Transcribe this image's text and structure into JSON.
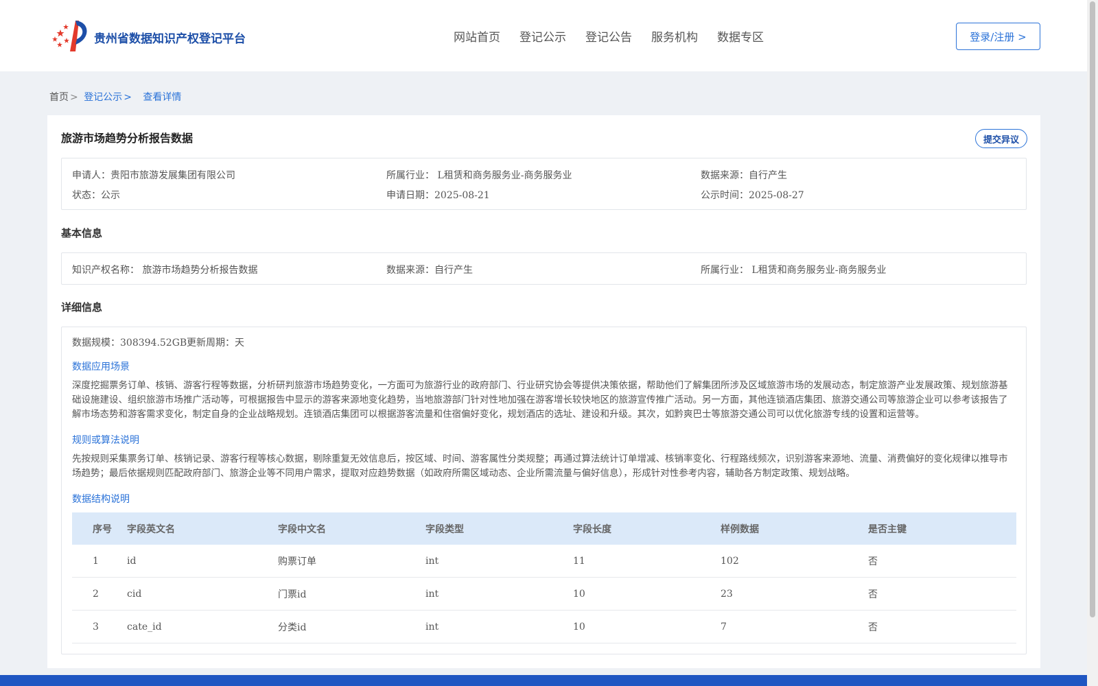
{
  "header": {
    "site_title": "贵州省数据知识产权登记平台",
    "nav": [
      "网站首页",
      "登记公示",
      "登记公告",
      "服务机构",
      "数据专区"
    ],
    "login_label": "登录/注册 >"
  },
  "breadcrumb": {
    "home": "首页",
    "sep": ">",
    "level2": "登记公示",
    "current": "查看详情"
  },
  "detail": {
    "title": "旅游市场趋势分析报告数据",
    "objection_label": "提交异议",
    "summary": {
      "applicant_label": "申请人：",
      "applicant": "贵阳市旅游发展集团有限公司",
      "industry_label": "所属行业：",
      "industry": "L租赁和商务服务业-商务服务业",
      "source_label": "数据来源：",
      "source": "自行产生",
      "status_label": "状态：",
      "status": "公示",
      "apply_date_label": "申请日期：",
      "apply_date": "2025-08-21",
      "publish_time_label": "公示时间：",
      "publish_time": "2025-08-27"
    }
  },
  "basic": {
    "section_title": "基本信息",
    "ip_name_label": "知识产权名称：",
    "ip_name": "旅游市场趋势分析报告数据",
    "source_label": "数据来源：",
    "source": "自行产生",
    "industry_label": "所属行业：",
    "industry": "L租赁和商务服务业-商务服务业"
  },
  "detailed": {
    "section_title": "详细信息",
    "scale_label": "数据规模：",
    "scale": "308394.52GB",
    "cycle_label": "更新周期：",
    "cycle": "天",
    "scenario_title": "数据应用场景",
    "scenario_text": "深度挖掘票务订单、核销、游客行程等数据，分析研判旅游市场趋势变化，一方面可为旅游行业的政府部门、行业研究协会等提供决策依据，帮助他们了解集团所涉及区域旅游市场的发展动态，制定旅游产业发展政策、规划旅游基础设施建设、组织旅游市场推广活动等，可根据报告中显示的游客来源地变化趋势，当地旅游部门针对性地加强在游客增长较快地区的旅游宣传推广活动。另一方面，其他连锁酒店集团、旅游交通公司等旅游企业可以参考该报告了解市场态势和游客需求变化，制定自身的企业战略规划。连锁酒店集团可以根据游客流量和住宿偏好变化，规划酒店的选址、建设和升级。其次，如黔爽巴士等旅游交通公司可以优化旅游专线的设置和运营等。",
    "rule_title": "规则或算法说明",
    "rule_text": "先按规则采集票务订单、核销记录、游客行程等核心数据，剔除重复无效信息后，按区域、时间、游客属性分类规整；再通过算法统计订单增减、核销率变化、行程路线频次，识别游客来源地、流量、消费偏好的变化规律以推导市场趋势；最后依据规则匹配政府部门、旅游企业等不同用户需求，提取对应趋势数据（如政府所需区域动态、企业所需流量与偏好信息），形成针对性参考内容，辅助各方制定政策、规划战略。",
    "structure_title": "数据结构说明",
    "table": {
      "headers": [
        "序号",
        "字段英文名",
        "字段中文名",
        "字段类型",
        "字段长度",
        "样例数据",
        "是否主键"
      ],
      "rows": [
        [
          "1",
          "id",
          "购票订单",
          "int",
          "11",
          "102",
          "否"
        ],
        [
          "2",
          "cid",
          "门票id",
          "int",
          "10",
          "23",
          "否"
        ],
        [
          "3",
          "cate_id",
          "分类id",
          "int",
          "10",
          "7",
          "否"
        ]
      ]
    }
  },
  "colors": {
    "brand": "#1d4fa8",
    "accent": "#2a72d8",
    "table_header_bg": "#dbe9f9",
    "footer": "#1f56c2"
  }
}
